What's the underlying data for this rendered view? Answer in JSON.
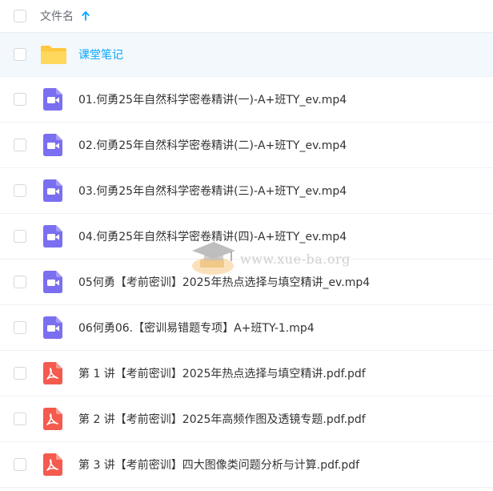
{
  "header": {
    "column_label": "文件名",
    "sort_icon": "arrow-up-icon"
  },
  "colors": {
    "accent": "#06a7ff",
    "folder": "#ffd24d",
    "video": "#7a6ff0",
    "pdf": "#f55a4e"
  },
  "rows": [
    {
      "name": "课堂笔记",
      "type": "folder",
      "icon": "folder-icon"
    },
    {
      "name": "01.何勇25年自然科学密卷精讲(一)-A+班TY_ev.mp4",
      "type": "video",
      "icon": "video-file-icon"
    },
    {
      "name": "02.何勇25年自然科学密卷精讲(二)-A+班TY_ev.mp4",
      "type": "video",
      "icon": "video-file-icon"
    },
    {
      "name": "03.何勇25年自然科学密卷精讲(三)-A+班TY_ev.mp4",
      "type": "video",
      "icon": "video-file-icon"
    },
    {
      "name": "04.何勇25年自然科学密卷精讲(四)-A+班TY_ev.mp4",
      "type": "video",
      "icon": "video-file-icon"
    },
    {
      "name": "05何勇【考前密训】2025年热点选择与填空精讲_ev.mp4",
      "type": "video",
      "icon": "video-file-icon"
    },
    {
      "name": "06何勇06.【密训易错题专项】A+班TY-1.mp4",
      "type": "video",
      "icon": "video-file-icon"
    },
    {
      "name": "第 1 讲【考前密训】2025年热点选择与填空精讲.pdf.pdf",
      "type": "pdf",
      "icon": "pdf-file-icon"
    },
    {
      "name": "第 2 讲【考前密训】2025年高频作图及透镜专题.pdf.pdf",
      "type": "pdf",
      "icon": "pdf-file-icon"
    },
    {
      "name": "第 3 讲【考前密训】四大图像类问题分析与计算.pdf.pdf",
      "type": "pdf",
      "icon": "pdf-file-icon"
    }
  ],
  "watermark": {
    "text": "www.xue-ba.org"
  }
}
